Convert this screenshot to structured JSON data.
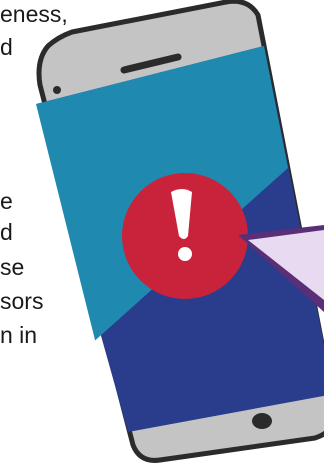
{
  "article": {
    "text_lines": [
      "eness,",
      "d",
      "e",
      "d",
      "se",
      "sors",
      "n in"
    ]
  },
  "illustration": {
    "icons": [
      "smartphone-icon",
      "exclamation-icon",
      "speech-bubble-icon"
    ],
    "colors": {
      "phone_body": "#c4c4c4",
      "phone_outline": "#2b2b2b",
      "screen_top": "#1f89b0",
      "screen_bottom": "#2a3c8c",
      "alert_circle": "#c8233a",
      "alert_mark": "#ffffff",
      "bubble_fill": "#e8daf0",
      "bubble_border": "#5a2f78"
    }
  }
}
